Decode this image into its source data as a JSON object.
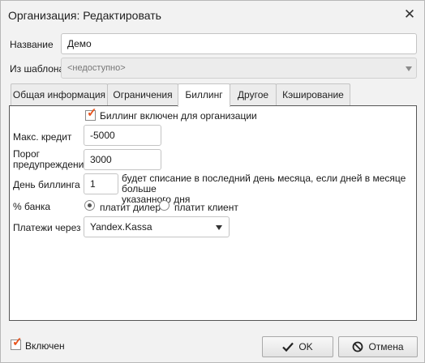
{
  "window": {
    "title": "Организация: Редактировать"
  },
  "fields": {
    "name_label": "Название",
    "name_value": "Демо",
    "template_label": "Из шаблона",
    "template_value": "<недоступно>"
  },
  "tabs": [
    {
      "label": "Общая информация",
      "active": false
    },
    {
      "label": "Ограничения",
      "active": false
    },
    {
      "label": "Биллинг",
      "active": true
    },
    {
      "label": "Другое",
      "active": false
    },
    {
      "label": "Кэширование",
      "active": false
    }
  ],
  "billing": {
    "enabled_label": "Биллинг включен для организации",
    "enabled_checked": true,
    "max_credit_label": "Макс. кредит",
    "max_credit_value": "-5000",
    "warn_threshold_label_line1": "Порог",
    "warn_threshold_label_line2": "предупреждения",
    "warn_threshold_value": "3000",
    "billing_day_label": "День биллинга",
    "billing_day_value": "1",
    "billing_day_hint_line1": "будет списание в последний день месяца, если дней в месяце больше",
    "billing_day_hint_line2": "указанного дня",
    "bank_percent_label": "% банка",
    "bank_options": [
      {
        "label": "платит дилер",
        "selected": true
      },
      {
        "label": "платит клиент",
        "selected": false
      }
    ],
    "payments_via_label": "Платежи через",
    "payments_via_value": "Yandex.Kassa"
  },
  "footer": {
    "enabled_label": "Включен",
    "enabled_checked": true,
    "ok_label": "OK",
    "cancel_label": "Отмена"
  },
  "colors": {
    "accent_check": "#e8541e",
    "panel_border": "#555555"
  },
  "icons": {
    "close": "close-icon",
    "ok": "checkmark-icon",
    "cancel": "cancel-circle-icon",
    "dropdown": "chevron-down-icon"
  }
}
